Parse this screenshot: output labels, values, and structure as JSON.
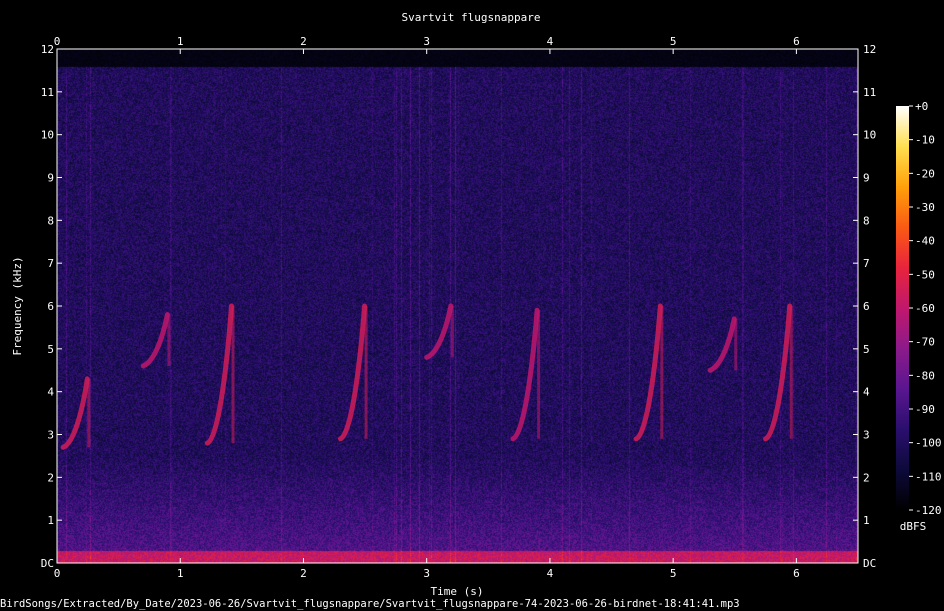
{
  "chart_data": {
    "type": "heatmap",
    "subtype": "spectrogram",
    "title": "Svartvit flugsnappare",
    "xlabel": "Time (s)",
    "ylabel": "Frequency (kHz)",
    "xlim": [
      0,
      6.5
    ],
    "ylim": [
      0,
      12
    ],
    "x_ticks": [
      "0",
      "1",
      "2",
      "3",
      "4",
      "5",
      "6"
    ],
    "y_ticks": [
      "DC",
      "1",
      "2",
      "3",
      "4",
      "5",
      "6",
      "7",
      "8",
      "9",
      "10",
      "11",
      "12"
    ],
    "colorbar": {
      "label": "dBFS",
      "range": [
        -120,
        0
      ],
      "ticks": [
        "+0",
        "-10",
        "-20",
        "-30",
        "-40",
        "-50",
        "-60",
        "-70",
        "-80",
        "-90",
        "-100",
        "-110",
        "-120"
      ],
      "colormap": [
        "#000000",
        "#0d0a3a",
        "#2a0f6e",
        "#5a1690",
        "#8c1a8a",
        "#c0186c",
        "#e8243c",
        "#fa5a14",
        "#ffa00a",
        "#ffe050",
        "#ffffff"
      ]
    },
    "signal_cutoff_khz": 11.6,
    "calls": [
      {
        "t": 0.05,
        "f_low": 2.7,
        "f_high": 4.3,
        "level_dbfs": -55
      },
      {
        "t": 0.7,
        "f_low": 4.6,
        "f_high": 5.8,
        "level_dbfs": -60
      },
      {
        "t": 1.22,
        "f_low": 2.8,
        "f_high": 6.0,
        "level_dbfs": -55
      },
      {
        "t": 2.3,
        "f_low": 2.9,
        "f_high": 6.0,
        "level_dbfs": -55
      },
      {
        "t": 3.0,
        "f_low": 4.8,
        "f_high": 6.0,
        "level_dbfs": -60
      },
      {
        "t": 3.7,
        "f_low": 2.9,
        "f_high": 5.9,
        "level_dbfs": -60
      },
      {
        "t": 4.7,
        "f_low": 2.9,
        "f_high": 6.0,
        "level_dbfs": -55
      },
      {
        "t": 5.3,
        "f_low": 4.5,
        "f_high": 5.7,
        "level_dbfs": -60
      },
      {
        "t": 5.75,
        "f_low": 2.9,
        "f_high": 6.0,
        "level_dbfs": -55
      }
    ]
  },
  "footer": {
    "file_path": "BirdSongs/Extracted/By_Date/2023-06-26/Svartvit_flugsnappare/Svartvit_flugsnappare-74-2023-06-26-birdnet-18:41:41.mp3"
  }
}
